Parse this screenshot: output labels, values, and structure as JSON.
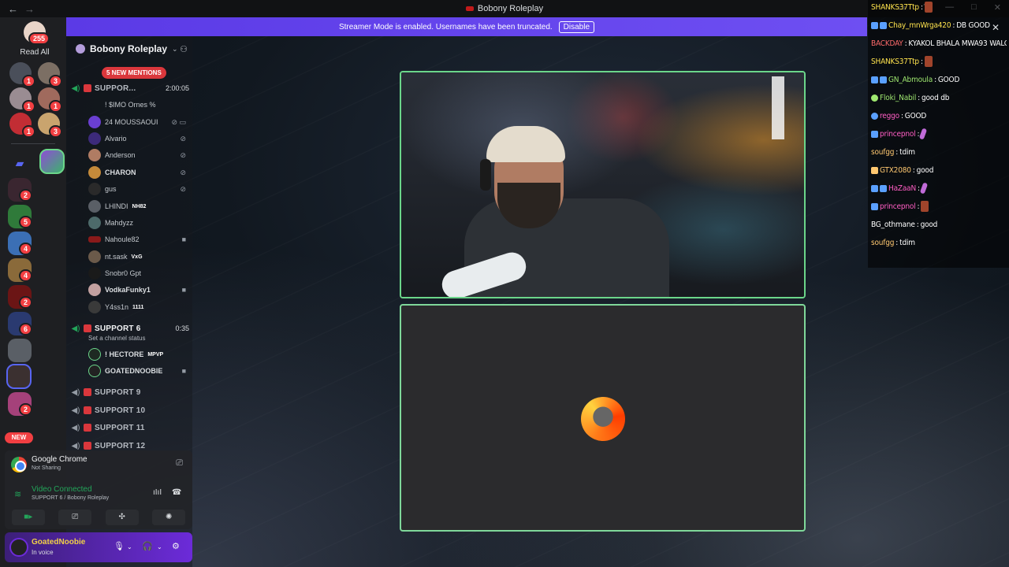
{
  "titlebar": {
    "title": "Bobony Roleplay",
    "back_icon": "←",
    "forward_icon": "→"
  },
  "rail": {
    "read_all_badge": "255",
    "read_all_label": "Read All",
    "dm_badges": [
      "1",
      "3",
      "1",
      "1",
      "1",
      "3"
    ],
    "server_badges": [
      "2",
      "5",
      "4",
      "4",
      "2",
      "6",
      "2"
    ],
    "new_label": "NEW"
  },
  "banner": {
    "text": "Streamer Mode is enabled. Usernames have been truncated.",
    "disable_label": "Disable"
  },
  "server": {
    "name": "Bobony Roleplay",
    "mentions_pill": "5 NEW MENTIONS",
    "support_channel_1": {
      "name": "SUPPOR...",
      "timer": "2:00:05"
    },
    "support_channel_2": {
      "name": "SUPPORT 6",
      "timer": "0:35",
      "status": "Set a channel status"
    },
    "members_1": [
      {
        "name": "! $IMO Ornes %",
        "extra": ""
      },
      {
        "name": "24 MOUSSAOUI",
        "extra": ""
      },
      {
        "name": "Alvario",
        "extra": ""
      },
      {
        "name": "Anderson",
        "extra": ""
      },
      {
        "name": "CHARON",
        "extra": ""
      },
      {
        "name": "gus",
        "extra": ""
      },
      {
        "name": "LHINDI",
        "extra": "NH82"
      },
      {
        "name": "Mahdyzz",
        "extra": ""
      },
      {
        "name": "Nahoule82",
        "extra": ""
      },
      {
        "name": "nt.sask",
        "extra": "VxG"
      },
      {
        "name": "Snobr0 Gpt",
        "extra": ""
      },
      {
        "name": "VodkaFunky1",
        "extra": ""
      },
      {
        "name": "Y4ss1n",
        "extra": "1111"
      }
    ],
    "members_2": [
      {
        "name": "! HECTORE",
        "extra": "MPVP"
      },
      {
        "name": "GOATEDNOOBIE",
        "extra": ""
      }
    ],
    "other_channels": [
      "SUPPORT 9",
      "SUPPORT 10",
      "SUPPORT 11",
      "SUPPORT 12"
    ]
  },
  "stream_panel": {
    "app_name": "Google Chrome",
    "app_status": "Not Sharing",
    "vc_status": "Video Connected",
    "vc_location": "SUPPORT 6 / Bobony Roleplay"
  },
  "user_panel": {
    "name": "GoatedNoobie",
    "status": "In voice"
  },
  "chat": {
    "messages": [
      {
        "user": "SHANKS37Ttp",
        "color": "#ffe34d",
        "text": ""
      },
      {
        "user": "Chay_mnWrga420",
        "color": "#ffe34d",
        "text": "DB GOOD"
      },
      {
        "user": "BACKDAY",
        "color": "#ff6b6b",
        "text": "KYAKOL BHALA MWA93 WALO"
      },
      {
        "user": "SHANKS37Ttp",
        "color": "#ffe34d",
        "text": ""
      },
      {
        "user": "GN_Abmoula",
        "color": "#9fe870",
        "text": "GOOD"
      },
      {
        "user": "Floki_Nabil",
        "color": "#9fe870",
        "text": "good db"
      },
      {
        "user": "reggo",
        "color": "#ff5ec4",
        "text": "GOOD"
      },
      {
        "user": "princepnol",
        "color": "#ff5ec4",
        "text": ""
      },
      {
        "user": "soufgg",
        "color": "#ffc870",
        "text": "tdim"
      },
      {
        "user": "GTX2080",
        "color": "#ffc870",
        "text": "good"
      },
      {
        "user": "HaZaaN",
        "color": "#ff5ec4",
        "text": ""
      },
      {
        "user": "princepnol",
        "color": "#ff5ec4",
        "text": ""
      },
      {
        "user": "BG_othmane",
        "color": "#ffffff",
        "text": "good"
      },
      {
        "user": "soufgg",
        "color": "#ffc870",
        "text": "tdim"
      }
    ]
  },
  "colors": {
    "accent": "#5865f2",
    "speaking": "#6bd68a",
    "online": "#23a55a",
    "badge": "#f23f42"
  }
}
